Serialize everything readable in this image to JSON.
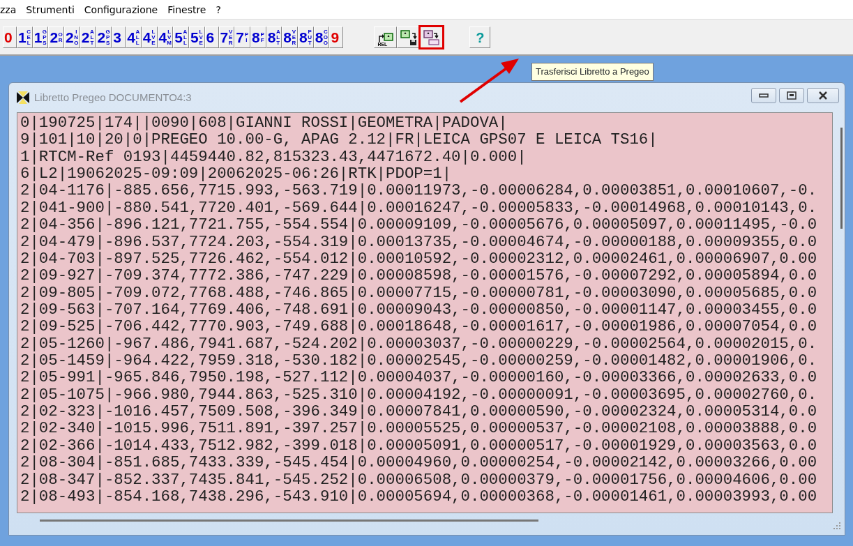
{
  "menu": [
    "zza",
    "Strumenti",
    "Configurazione",
    "Finestre",
    "?"
  ],
  "toolbar": [
    {
      "digit": "0",
      "color": "#e00000"
    },
    {
      "digit": "1",
      "sub": "CEL",
      "color": "#0000d0"
    },
    {
      "digit": "1",
      "sub": "GPS",
      "color": "#0000d0"
    },
    {
      "digit": "2",
      "sub": "OR",
      "color": "#0000d0"
    },
    {
      "digit": "2",
      "sub": "INO",
      "color": "#0000d0"
    },
    {
      "digit": "2",
      "sub": "ALT",
      "color": "#0000d0"
    },
    {
      "digit": "2",
      "sub": "GPS",
      "color": "#0000d0"
    },
    {
      "digit": "3",
      "color": "#0000d0"
    },
    {
      "digit": "4",
      "sub": "ALL",
      "color": "#0000d0"
    },
    {
      "digit": "4",
      "sub": "LVE",
      "color": "#0000d0"
    },
    {
      "digit": "4",
      "sub": "LVM",
      "color": "#0000d0"
    },
    {
      "digit": "5",
      "sub": "ALL",
      "color": "#0000d0"
    },
    {
      "digit": "5",
      "sub": "LVE",
      "color": "#0000d0"
    },
    {
      "digit": "6",
      "color": "#0000d0"
    },
    {
      "digit": "7",
      "sub": "VER",
      "color": "#0000d0"
    },
    {
      "digit": "7",
      "sub": "PI",
      "color": "#0000d0"
    },
    {
      "digit": "8",
      "sub": "PF",
      "color": "#0000d0"
    },
    {
      "digit": "8",
      "sub": "ALT",
      "color": "#0000d0"
    },
    {
      "digit": "8",
      "sub": "VER",
      "color": "#0000d0"
    },
    {
      "digit": "8",
      "sub": "PUT",
      "color": "#0000d0"
    },
    {
      "digit": "8",
      "sub": "COO",
      "color": "#0000d0"
    },
    {
      "digit": "9",
      "color": "#e00000"
    }
  ],
  "tools": [
    {
      "kind": "import",
      "label": "REL",
      "highlighted": false
    },
    {
      "kind": "save",
      "highlighted": false
    },
    {
      "kind": "transfer",
      "highlighted": true
    }
  ],
  "help_button": {
    "label": "?"
  },
  "tooltip": "Trasferisci Libretto a Pregeo",
  "window": {
    "title": "Libretto Pregeo DOCUMENTO4:3",
    "lines": [
      "0|190725|174||0090|608|GIANNI ROSSI|GEOMETRA|PADOVA|",
      "9|101|10|20|0|PREGEO 10.00-G, APAG 2.12|FR|LEICA GPS07 E LEICA TS16|",
      "1|RTCM-Ref 0193|4459440.82,815323.43,4471672.40|0.000|",
      "6|L2|19062025-09:09|20062025-06:26|RTK|PDOP=1|",
      "2|04-1176|-885.656,7715.993,-563.719|0.00011973,-0.00006284,0.00003851,0.00010607,-0.",
      "2|041-900|-880.541,7720.401,-569.644|0.00016247,-0.00005833,-0.00014968,0.00010143,0.",
      "2|04-356|-896.121,7721.755,-554.554|0.00009109,-0.00005676,0.00005097,0.00011495,-0.0",
      "2|04-479|-896.537,7724.203,-554.319|0.00013735,-0.00004674,-0.00000188,0.00009355,0.0",
      "2|04-703|-897.525,7726.462,-554.012|0.00010592,-0.00002312,0.00002461,0.00006907,0.00",
      "2|09-927|-709.374,7772.386,-747.229|0.00008598,-0.00001576,-0.00007292,0.00005894,0.0",
      "2|09-805|-709.072,7768.488,-746.865|0.00007715,-0.00000781,-0.00003090,0.00005685,0.0",
      "2|09-563|-707.164,7769.406,-748.691|0.00009043,-0.00000850,-0.00001147,0.00003455,0.0",
      "2|09-525|-706.442,7770.903,-749.688|0.00018648,-0.00001617,-0.00001986,0.00007054,0.0",
      "2|05-1260|-967.486,7941.687,-524.202|0.00003037,-0.00000229,-0.00002564,0.00002015,0.",
      "2|05-1459|-964.422,7959.318,-530.182|0.00002545,-0.00000259,-0.00001482,0.00001906,0.",
      "2|05-991|-965.846,7950.198,-527.112|0.00004037,-0.00000160,-0.00003366,0.00002633,0.0",
      "2|05-1075|-966.980,7944.863,-525.310|0.00004192,-0.00000091,-0.00003695,0.00002760,0.",
      "2|02-323|-1016.457,7509.508,-396.349|0.00007841,0.00000590,-0.00002324,0.00005314,0.0",
      "2|02-340|-1015.996,7511.891,-397.257|0.00005525,0.00000537,-0.00002108,0.00003888,0.0",
      "2|02-366|-1014.433,7512.982,-399.018|0.00005091,0.00000517,-0.00001929,0.00003563,0.0",
      "2|08-304|-851.685,7433.339,-545.454|0.00004960,0.00000254,-0.00002142,0.00003266,0.00",
      "2|08-347|-852.337,7435.841,-545.252|0.00006508,0.00000379,-0.00001756,0.00004606,0.00",
      "2|08-493|-854.168,7438.296,-543.910|0.00005694,0.00000368,-0.00001461,0.00003993,0.00"
    ]
  }
}
